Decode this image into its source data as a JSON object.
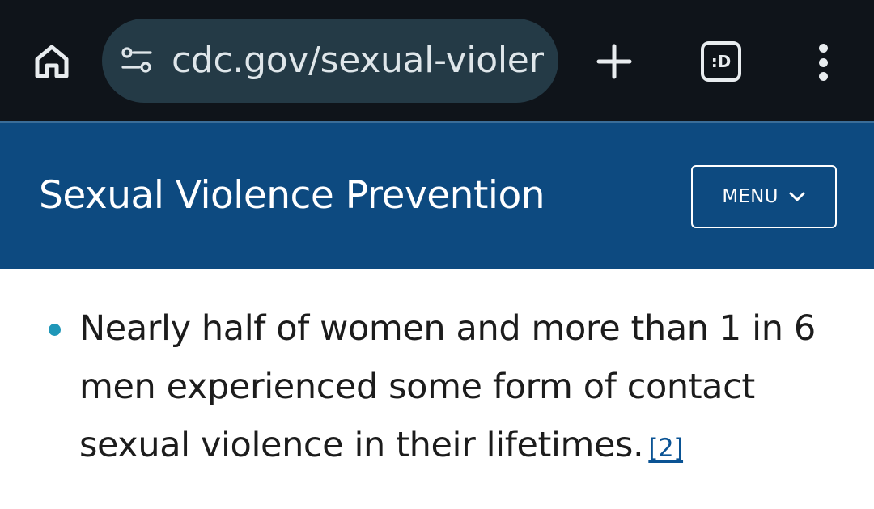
{
  "browser": {
    "url": "cdc.gov/sexual-violenc",
    "tabs_label": ":D"
  },
  "header": {
    "title": "Sexual Violence Prevention",
    "menu_label": "MENU"
  },
  "content": {
    "bullet_text": "Nearly half of women and more than 1 in 6 men experienced some form of contact sexual violence in their lifetimes.",
    "citation": "[2]"
  },
  "icons": {
    "home": "home-icon",
    "site_settings": "tune-icon",
    "new_tab": "plus-icon",
    "overflow": "more-vert-icon",
    "menu_chevron": "chevron-down-icon"
  },
  "colors": {
    "toolbar_bg": "#0f141a",
    "url_pill_bg": "#243a46",
    "header_bg": "#0d4a80",
    "bullet": "#1f97b8",
    "link": "#0a5394"
  }
}
